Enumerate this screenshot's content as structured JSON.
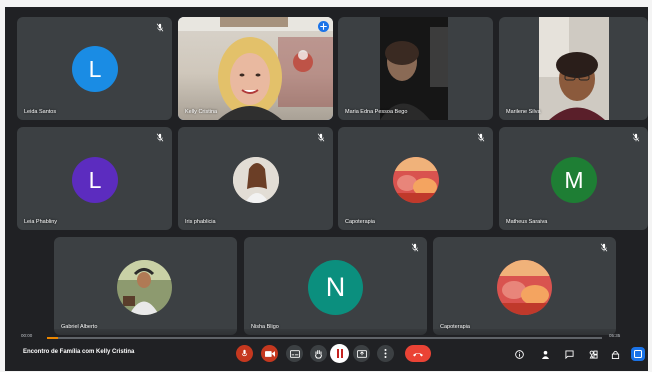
{
  "participants": [
    {
      "id": "leida",
      "name": "Leida Santos",
      "initial": "L",
      "avatar_color": "#1a8ce4",
      "kind": "initial"
    },
    {
      "id": "kelly",
      "name": "Kelly Cristina",
      "kind": "video",
      "active": true
    },
    {
      "id": "maria",
      "name": "Maria Edna Pessoa Bego",
      "kind": "video"
    },
    {
      "id": "marilene",
      "name": "Marilene Silva",
      "kind": "video"
    },
    {
      "id": "leia",
      "name": "Leia Phabliny",
      "initial": "L",
      "avatar_color": "#5c2cbf",
      "kind": "initial"
    },
    {
      "id": "iris",
      "name": "Iris phablicia",
      "kind": "photo"
    },
    {
      "id": "capoterapia",
      "name": "Capoterapia",
      "kind": "photo"
    },
    {
      "id": "matheus",
      "name": "Matheus Saraiva",
      "initial": "M",
      "avatar_color": "#1e7e34",
      "kind": "initial"
    },
    {
      "id": "gabriel",
      "name": "Gabriel Alberto",
      "kind": "photo"
    },
    {
      "id": "nisha",
      "name": "Nisha Bligo",
      "initial": "N",
      "avatar_color": "#0b8f7e",
      "kind": "initial"
    },
    {
      "id": "capoterapia2",
      "name": "Capoterapia",
      "kind": "photo"
    }
  ],
  "player": {
    "current_time": "00:00",
    "total_time": "05:35",
    "progress": 0.02
  },
  "meeting": {
    "title": "Encontro de Família com Kelly Cristina"
  },
  "colors": {
    "end_call": "#ea4335",
    "active_outline": "#8ab4f8",
    "progress": "#ea8600"
  }
}
